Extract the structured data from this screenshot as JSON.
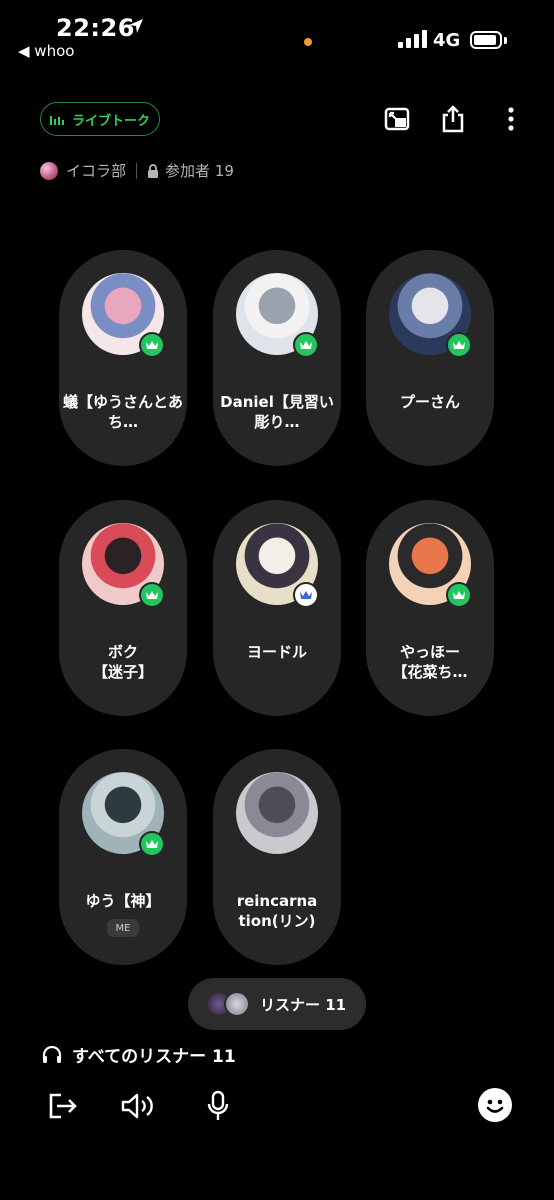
{
  "status_bar": {
    "time": "22:26",
    "back_app": "◀ whoo",
    "network": "4G",
    "signal_bars": 4,
    "battery_level": 0.8
  },
  "header": {
    "live_label": "ライブトーク",
    "room_name": "イコラ部",
    "participants_label": "参加者 19"
  },
  "speakers": [
    {
      "name": "蟻【ゆうさんとあち…",
      "badge": "crown-green",
      "avatar_colors": [
        "#f5e6ea",
        "#e9a7bd",
        "#7a8ec4"
      ]
    },
    {
      "name": "Daniel【見習い彫り…",
      "badge": "crown-green",
      "avatar_colors": [
        "#dfe4ea",
        "#9aa3ad",
        "#f2f2f2"
      ]
    },
    {
      "name": "プーさん",
      "badge": "crown-green",
      "avatar_colors": [
        "#2b3a5c",
        "#e4e4ea",
        "#6a7da8"
      ]
    },
    {
      "name": "ボク\n【迷子】",
      "badge": "crown-green",
      "avatar_colors": [
        "#f0c9c9",
        "#2a2226",
        "#d94b58"
      ]
    },
    {
      "name": "ヨードル",
      "badge": "crown-white",
      "avatar_colors": [
        "#e8dfc8",
        "#f2f0e6",
        "#3a3342"
      ]
    },
    {
      "name": "やっほー\n【花菜ち…",
      "badge": "crown-green",
      "avatar_colors": [
        "#f4d2b8",
        "#e8784b",
        "#2a2a2a"
      ]
    },
    {
      "name": "ゆう【神】",
      "badge": "crown-green",
      "avatar_colors": [
        "#9fb3b8",
        "#2d3a3e",
        "#c8d4d6"
      ],
      "tag": "ME"
    },
    {
      "name": "reincarna\ntion(リン)",
      "badge": "none",
      "avatar_colors": [
        "#c9c9cf",
        "#4d4d59",
        "#8a8a96"
      ]
    }
  ],
  "listener_pill": {
    "label": "リスナー 11"
  },
  "all_listeners": {
    "label": "すべてのリスナー 11"
  },
  "colors": {
    "accent_green": "#2fd35a",
    "card_bg": "#262626",
    "background": "#000000"
  }
}
